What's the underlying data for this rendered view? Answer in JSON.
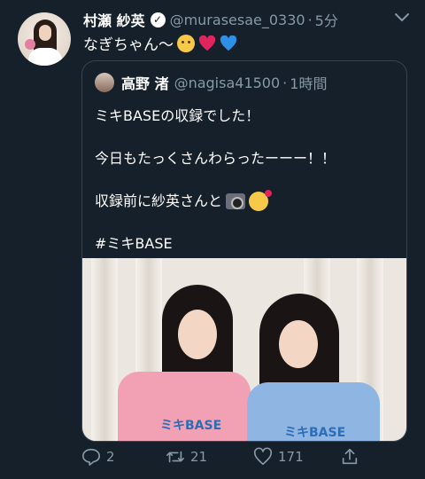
{
  "tweet": {
    "author_name": "村瀬 紗英",
    "author_handle": "@murasesae_0330",
    "separator": "·",
    "time": "5分",
    "text": "なぎちゃん〜",
    "emojis": [
      "smiling-face",
      "red-heart",
      "blue-heart"
    ]
  },
  "quote": {
    "author_name": "高野 渚",
    "author_handle": "@nagisa41500",
    "separator": "·",
    "time": "1時間",
    "lines": [
      "ミキBASEの収録でした！",
      "今日もたっくさんわらったーーー！！",
      "収録前に紗英さんと",
      "#ミキBASE"
    ],
    "line3_emojis": [
      "camera-flash",
      "smiling-face-with-hearts"
    ],
    "photo_shirt_text": "ミキBASE"
  },
  "actions": {
    "reply_count": "2",
    "retweet_count": "21",
    "like_count": "171"
  },
  "colors": {
    "background": "#15202b",
    "secondary_text": "#8899a6",
    "border": "#38444d"
  }
}
